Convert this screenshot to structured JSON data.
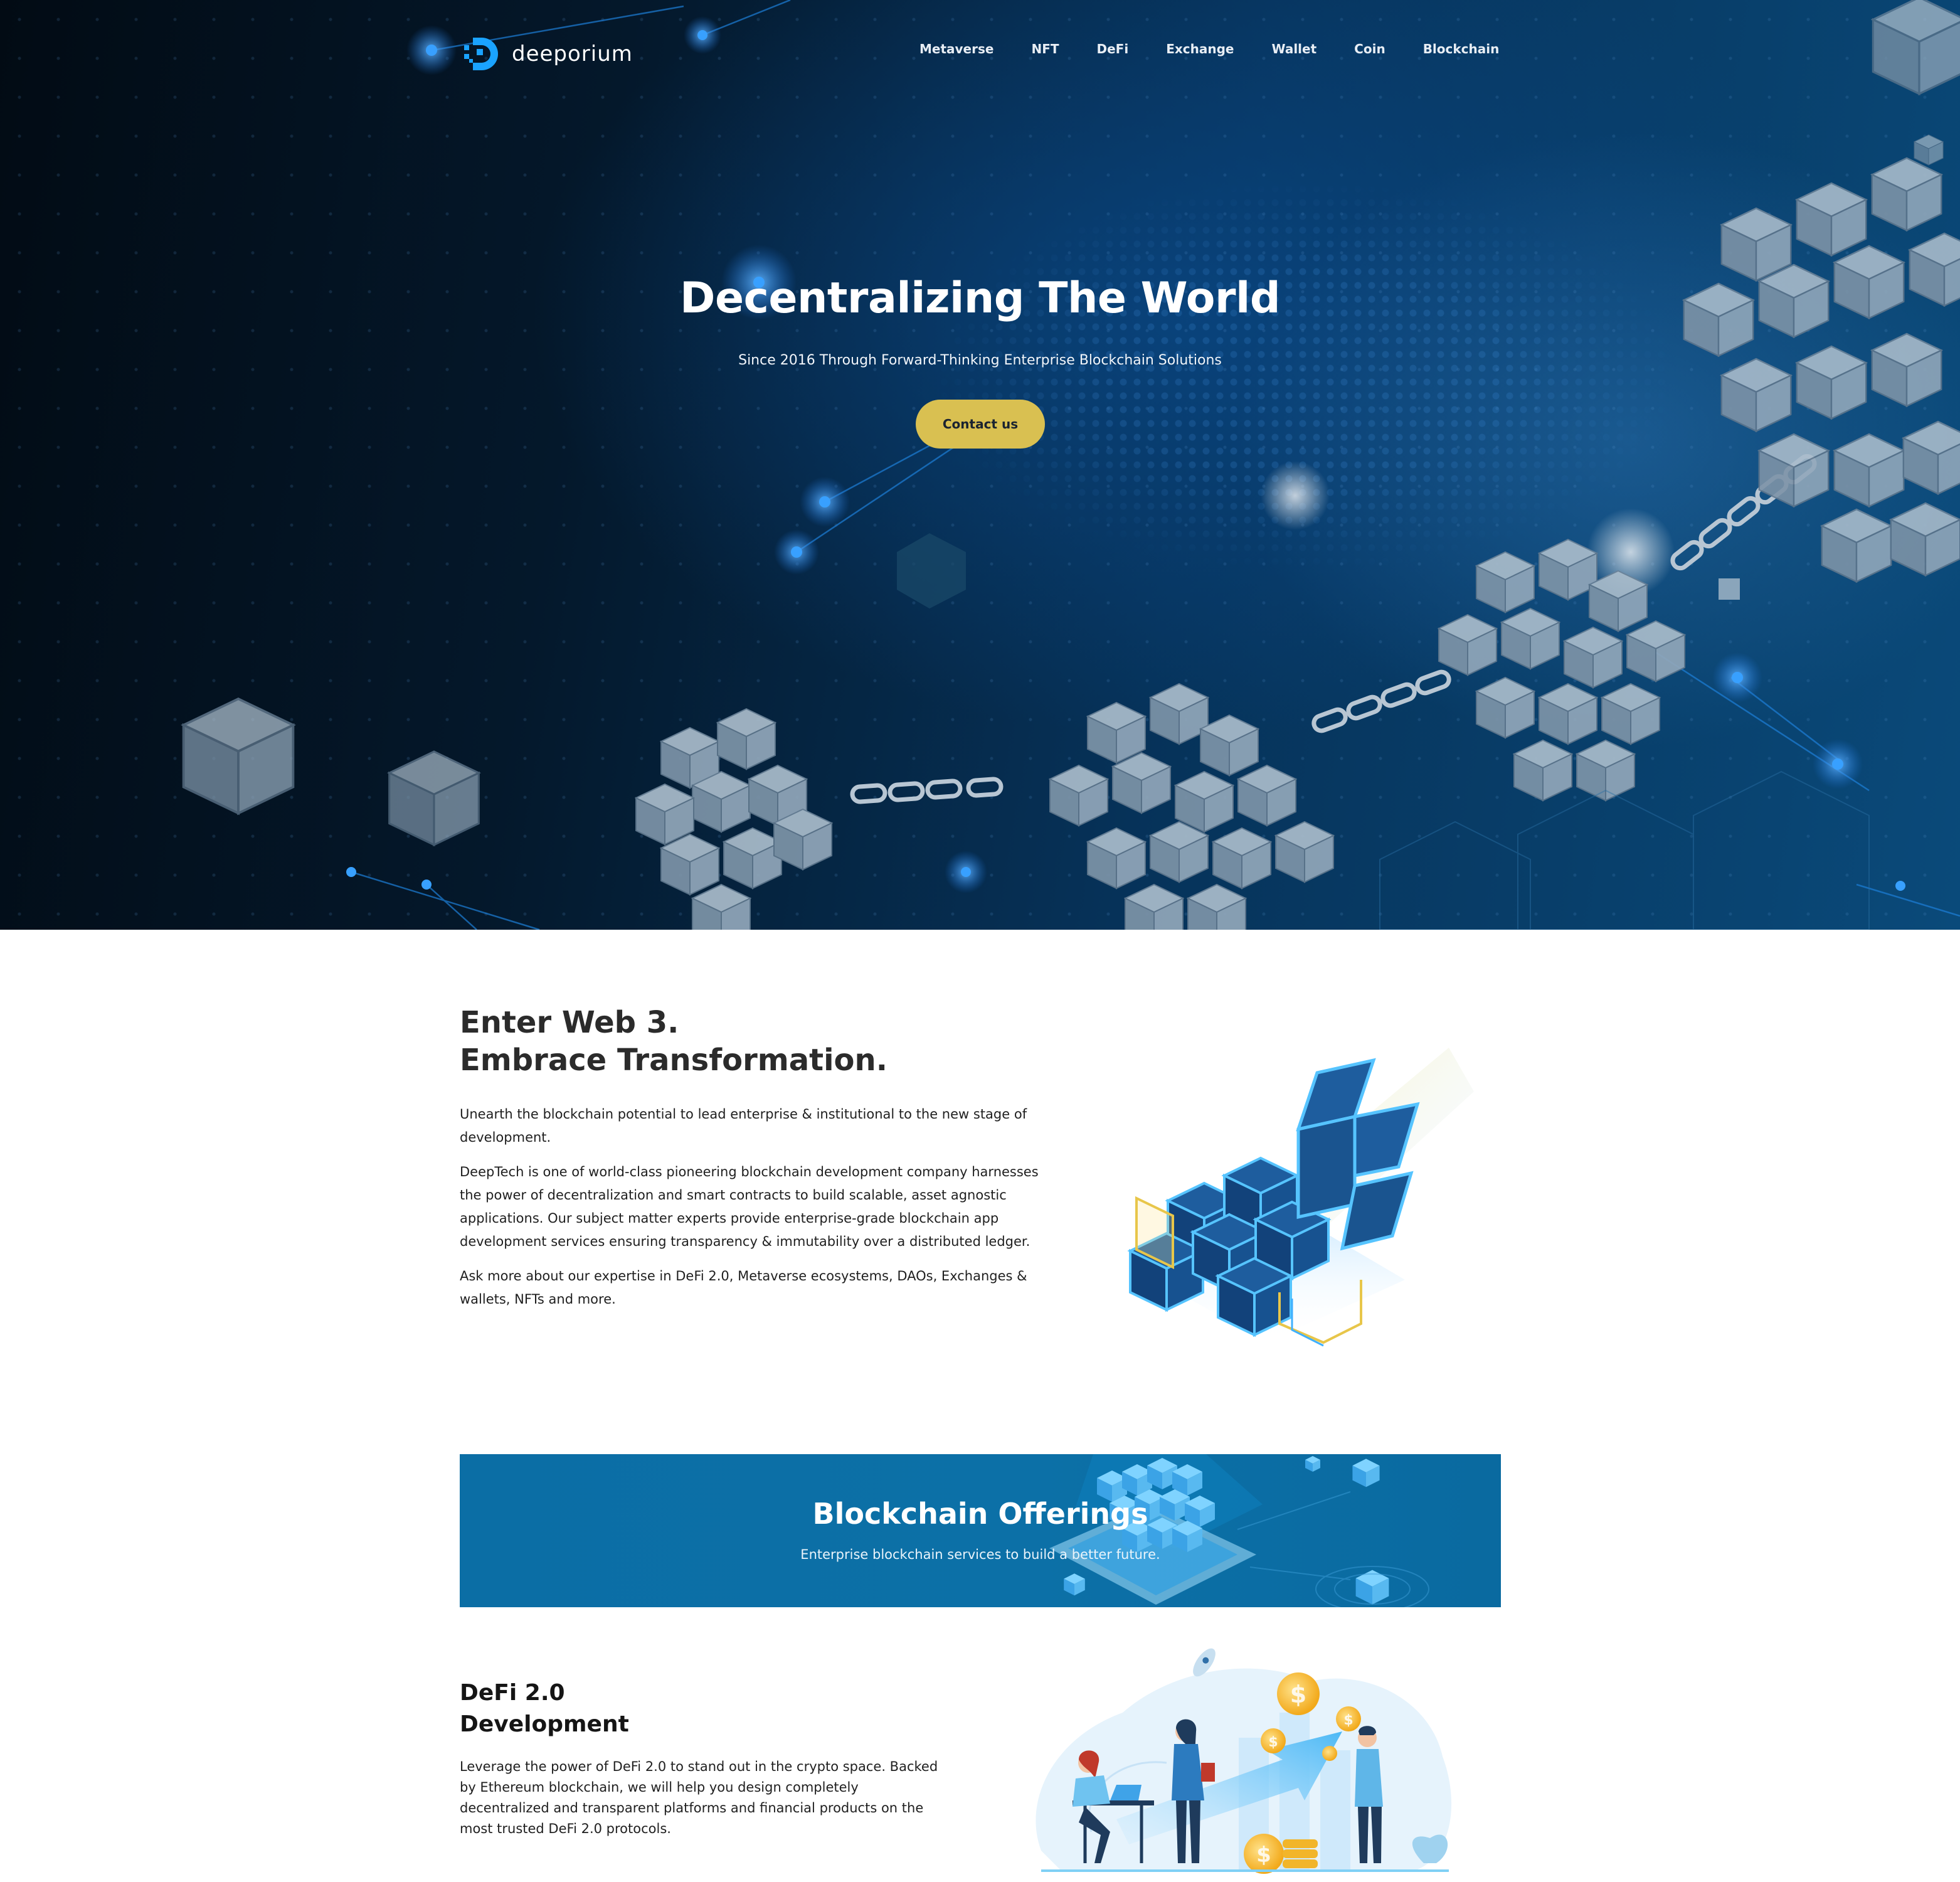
{
  "brand": {
    "name": "deeporium",
    "accent_color": "#1aa3ff",
    "cta_color": "#d9c051",
    "hero_bg": "#04182b",
    "banner_bg": "#0b6ea5"
  },
  "nav": {
    "items": [
      {
        "label": "Metaverse"
      },
      {
        "label": "NFT"
      },
      {
        "label": "DeFi"
      },
      {
        "label": "Exchange"
      },
      {
        "label": "Wallet"
      },
      {
        "label": "Coin"
      },
      {
        "label": "Blockchain"
      }
    ]
  },
  "hero": {
    "title": "Decentralizing The World",
    "subtitle": "Since 2016 Through Forward-Thinking Enterprise Blockchain Solutions",
    "cta_label": "Contact us",
    "illustration": "blockchain-cubes-chain"
  },
  "web3": {
    "title_line1": "Enter Web 3.",
    "title_line2": "Embrace Transformation.",
    "paragraphs": [
      "Unearth the blockchain potential to lead enterprise & institutional to the new stage of development.",
      "DeepTech is one of world-class pioneering blockchain development company harnesses the power of decentralization and smart contracts to build scalable, asset agnostic applications. Our subject matter experts provide enterprise-grade blockchain app development services ensuring transparency & immutability over a distributed ledger.",
      "Ask more about our expertise in DeFi 2.0, Metaverse ecosystems, DAOs, Exchanges & wallets, NFTs and more."
    ],
    "illustration": "isometric-blockchain-cubes"
  },
  "offerings": {
    "title": "Blockchain Offerings",
    "subtitle": "Enterprise blockchain services to build a better future."
  },
  "defi": {
    "title_line1": "DeFi 2.0",
    "title_line2": "Development",
    "paragraph": "Leverage the power of DeFi 2.0 to stand out in the crypto space. Backed by Ethereum blockchain, we will help you design completely decentralized and transparent platforms and financial products on the most trusted DeFi 2.0 protocols.",
    "illustration": "people-growth-coins"
  }
}
